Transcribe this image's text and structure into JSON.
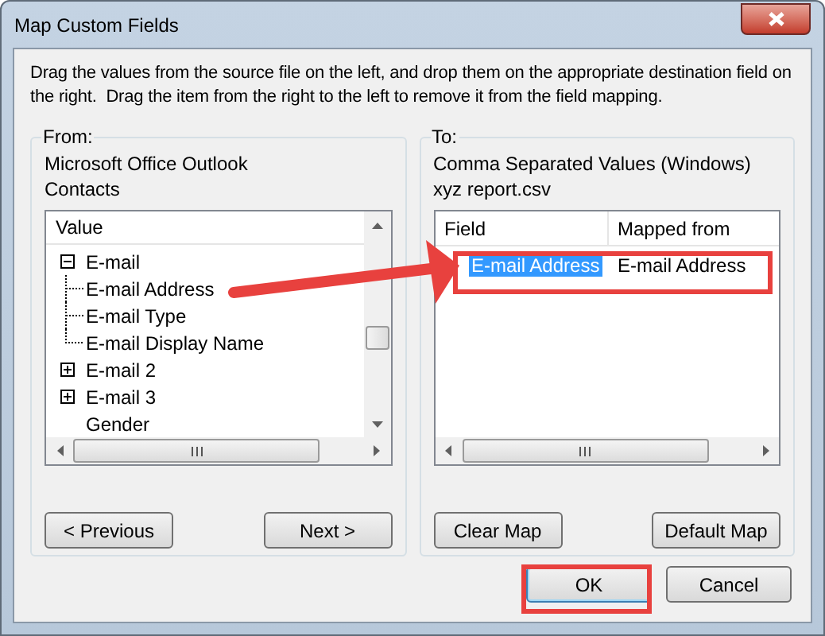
{
  "window": {
    "title": "Map Custom Fields"
  },
  "instructions": "Drag the values from the source file on the left, and drop them on the appropriate destination field on the right.  Drag the item from the right to the left to remove it from the field mapping.",
  "from": {
    "label": "From:",
    "lines": [
      "Microsoft Office Outlook",
      "Contacts"
    ],
    "list_header": "Value",
    "tree": [
      {
        "label": "E-mail",
        "expanded": true,
        "children": [
          {
            "label": "E-mail Address"
          },
          {
            "label": "E-mail Type"
          },
          {
            "label": "E-mail Display Name"
          }
        ]
      },
      {
        "label": "E-mail 2",
        "expanded": false
      },
      {
        "label": "E-mail 3",
        "expanded": false
      },
      {
        "label": "Gender"
      }
    ],
    "buttons": [
      "< Previous",
      "Next >"
    ]
  },
  "to": {
    "label": "To:",
    "lines": [
      "Comma Separated Values (Windows)",
      "xyz report.csv"
    ],
    "columns": [
      "Field",
      "Mapped from"
    ],
    "rows": [
      {
        "field": "E-mail Address",
        "mapped_from": "E-mail Address",
        "selected": true
      }
    ],
    "buttons": [
      "Clear Map",
      "Default Map"
    ]
  },
  "footer_buttons": [
    {
      "label": "OK",
      "focused": true
    },
    {
      "label": "Cancel",
      "focused": false
    }
  ]
}
